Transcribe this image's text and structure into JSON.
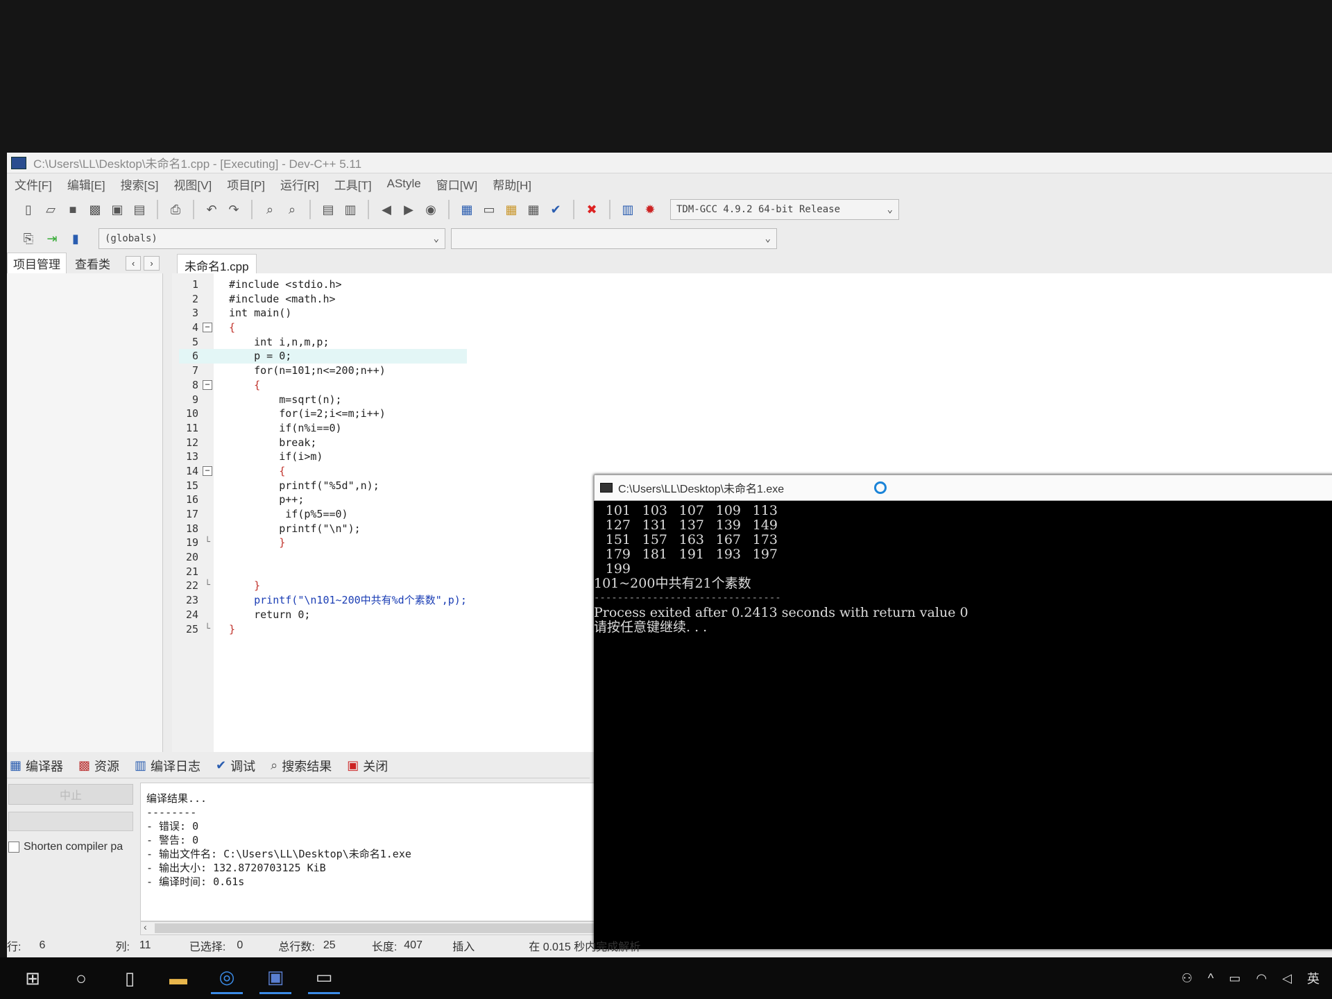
{
  "window": {
    "title": "C:\\Users\\LL\\Desktop\\未命名1.cpp - [Executing] - Dev-C++ 5.11"
  },
  "menu": [
    "文件[F]",
    "编辑[E]",
    "搜索[S]",
    "视图[V]",
    "项目[P]",
    "运行[R]",
    "工具[T]",
    "AStyle",
    "窗口[W]",
    "帮助[H]"
  ],
  "toolbar": {
    "compiler": "TDM-GCC 4.9.2 64-bit Release",
    "scope": "(globals)",
    "function": ""
  },
  "left_panel": {
    "tabs": [
      "项目管理",
      "查看类"
    ],
    "arrows": [
      "‹",
      "›"
    ]
  },
  "editor": {
    "file_tab": "未命名1.cpp",
    "lines": [
      "#include <stdio.h>",
      "#include <math.h>",
      "int main()",
      "{",
      "    int i,n,m,p;",
      "    p = 0;",
      "    for(n=101;n<=200;n++)",
      "    {",
      "        m=sqrt(n);",
      "        for(i=2;i<=m;i++)",
      "        if(n%i==0)",
      "        break;",
      "        if(i>m)",
      "        {",
      "        printf(\"%5d\",n);",
      "        p++;",
      "         if(p%5==0)",
      "        printf(\"\\n\");",
      "        }",
      "",
      "",
      "    }",
      "    printf(\"\\n101~200中共有%d个素数\",p);",
      "    return 0;",
      "}"
    ]
  },
  "console": {
    "title": "C:\\Users\\LL\\Desktop\\未命名1.exe",
    "rows": [
      [
        "101",
        "103",
        "107",
        "109",
        "113"
      ],
      [
        "127",
        "131",
        "137",
        "139",
        "149"
      ],
      [
        "151",
        "157",
        "163",
        "167",
        "173"
      ],
      [
        "179",
        "181",
        "191",
        "193",
        "197"
      ],
      [
        "199"
      ]
    ],
    "summary": "101~200中共有21个素数",
    "separator": "--------------------------------",
    "exit_message": "Process exited after 0.2413 seconds with return value 0",
    "press_key": "请按任意键继续. . ."
  },
  "bottom": {
    "tabs": [
      "编译器",
      "资源",
      "编译日志",
      "调试",
      "搜索结果",
      "关闭"
    ],
    "abort": "中止",
    "shorten": "Shorten compiler pa",
    "log": [
      "编译结果...",
      "--------",
      "- 错误: 0",
      "- 警告: 0",
      "- 输出文件名: C:\\Users\\LL\\Desktop\\未命名1.exe",
      "- 输出大小: 132.8720703125 KiB",
      "- 编译时间: 0.61s"
    ]
  },
  "status": {
    "row_label": "行:",
    "row": "6",
    "col_label": "列:",
    "col": "11",
    "sel_label": "已选择:",
    "sel": "0",
    "total_label": "总行数:",
    "total": "25",
    "len_label": "长度:",
    "len": "407",
    "mode": "插入",
    "parse": "在 0.015 秒内完成解析"
  },
  "tray": {
    "ime": "英"
  }
}
